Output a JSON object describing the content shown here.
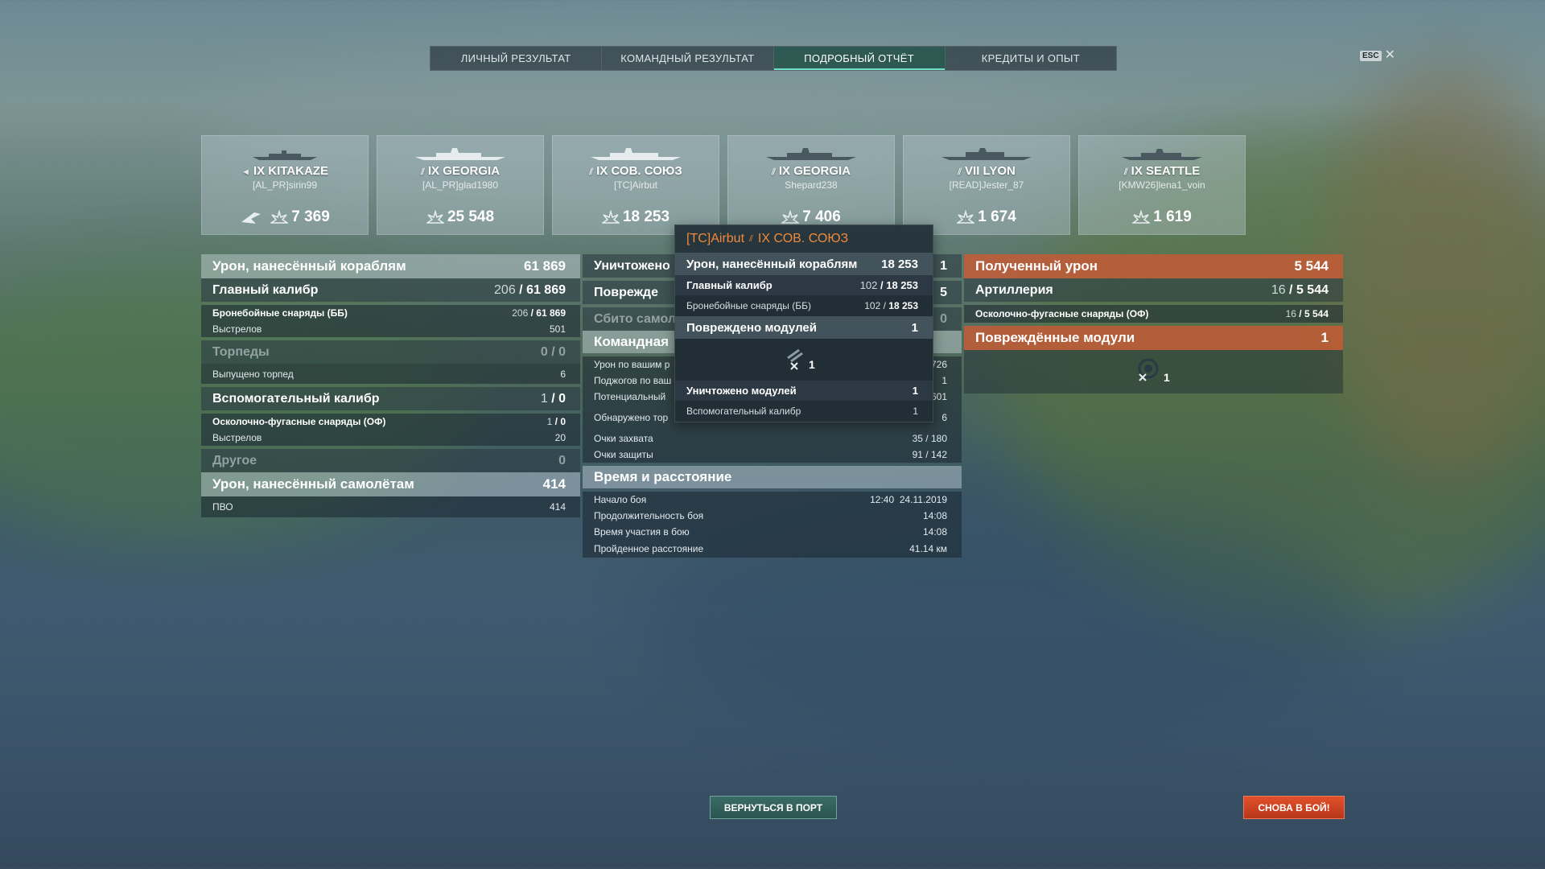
{
  "tabs": [
    "ЛИЧНЫЙ РЕЗУЛЬТАТ",
    "КОМАНДНЫЙ РЕЗУЛЬТАТ",
    "ПОДРОБНЫЙ ОТЧЁТ",
    "КРЕДИТЫ И ОПЫТ"
  ],
  "active_tab": "ПОДРОБНЫЙ ОТЧЁТ",
  "esc_label": "ESC",
  "close_glyph": "✕",
  "ships": [
    {
      "tier_name": "IX KITAKAZE",
      "player": "[AL_PR]sirin99",
      "damage": "7 369",
      "class_icon": "destroyer-icon"
    },
    {
      "tier_name": "IX GEORGIA",
      "player": "[AL_PR]glad1980",
      "damage": "25 548",
      "class_icon": "battleship-icon"
    },
    {
      "tier_name": "IX СОВ. СОЮЗ",
      "player": "[TC]Airbut",
      "damage": "18 253",
      "class_icon": "battleship-icon"
    },
    {
      "tier_name": "IX GEORGIA",
      "player": "Shepard238",
      "damage": "7 406",
      "class_icon": "battleship-icon"
    },
    {
      "tier_name": "VII LYON",
      "player": "[READ]Jester_87",
      "damage": "1 674",
      "class_icon": "battleship-icon"
    },
    {
      "tier_name": "IX SEATTLE",
      "player": "[KMW26]lena1_voin",
      "damage": "1 619",
      "class_icon": "cruiser-icon"
    }
  ],
  "left": {
    "ship_damage_label": "Урон, нанесённый кораблям",
    "ship_damage_value": "61 869",
    "main_label": "Главный калибр",
    "main_a": "206",
    "main_b": "61 869",
    "ap_label": "Бронебойные снаряды (ББ)",
    "ap_a": "206",
    "ap_b": "61 869",
    "shots_label": "Выстрелов",
    "shots_value": "501",
    "torp_label": "Торпеды",
    "torp_a": "0",
    "torp_b": "0",
    "torp_fired_label": "Выпущено торпед",
    "torp_fired_value": "6",
    "sec_label": "Вспомогательный калибр",
    "sec_a": "1",
    "sec_b": "0",
    "he_label": "Осколочно-фугасные снаряды (ОФ)",
    "he_a": "1",
    "he_b": "0",
    "sec_shots_label": "Выстрелов",
    "sec_shots_value": "20",
    "other_label": "Другое",
    "other_value": "0",
    "plane_damage_label": "Урон, нанесённый самолётам",
    "plane_damage_value": "414",
    "aa_label": "ПВО",
    "aa_value": "414"
  },
  "middle": {
    "destroyed_label": "Уничтожено",
    "destroyed_value": "1",
    "damaged_label": "Поврежде",
    "damaged_value": "5",
    "shot_down_label": "Сбито самол",
    "shot_down_value": "0",
    "team_label": "Командная",
    "team_lines": [
      {
        "label": "Урон по вашим р",
        "value": "726"
      },
      {
        "label": "Поджогов по ваш",
        "value": "1"
      },
      {
        "label": "Потенциальный",
        "value": "601"
      },
      {
        "label": "Обнаружено тор",
        "value": "6"
      },
      {
        "label": "Очки захвата",
        "value": "35 / 180"
      },
      {
        "label": "Очки защиты",
        "value": "91 / 142"
      }
    ],
    "time_label": "Время и расстояние",
    "start_label": "Начало боя",
    "start_time": "12:40",
    "start_date": "24.11.2019",
    "duration_label": "Продолжительность боя",
    "duration_value": "14:08",
    "participation_label": "Время участия в бою",
    "participation_value": "14:08",
    "distance_label": "Пройденное расстояние",
    "distance_value": "41.14 км"
  },
  "right": {
    "received_label": "Полученный урон",
    "received_value": "5 544",
    "artillery_label": "Артиллерия",
    "artillery_a": "16",
    "artillery_b": "5 544",
    "he_label": "Осколочно-фугасные снаряды (ОФ)",
    "he_a": "16",
    "he_b": "5 544",
    "modules_label": "Повреждённые модули",
    "modules_value": "1",
    "module_count": "1"
  },
  "tooltip": {
    "player": "[TC]Airbut",
    "ship": "IX СОВ. СОЮЗ",
    "ship_damage_label": "Урон, нанесённый кораблям",
    "ship_damage_value": "18 253",
    "main_label": "Главный калибр",
    "main_a": "102",
    "main_b": "18 253",
    "ap_label": "Бронебойные снаряды (ББ)",
    "ap_a": "102",
    "ap_b": "18 253",
    "damaged_modules_label": "Повреждено модулей",
    "damaged_modules_value": "1",
    "module_count": "1",
    "destroyed_modules_label": "Уничтожено модулей",
    "destroyed_modules_value": "1",
    "secondary_label": "Вспомогательный калибр",
    "secondary_value": "1"
  },
  "buttons": {
    "port": "ВЕРНУТЬСЯ В ПОРТ",
    "battle": "СНОВА В БОЙ!"
  },
  "colors": {
    "accent_red": "#c85a34",
    "tab_active": "#285c50",
    "tooltip_orange": "#f08a3a"
  }
}
